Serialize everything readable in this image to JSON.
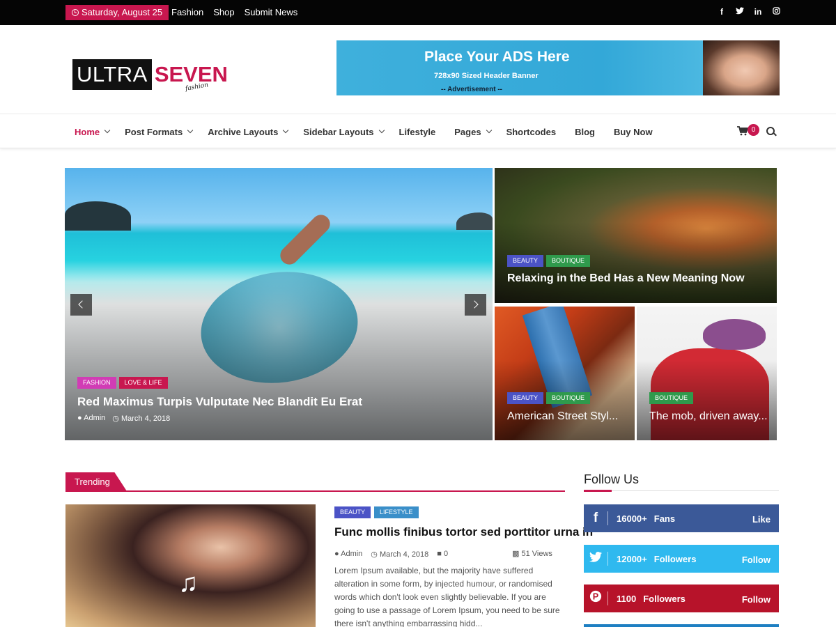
{
  "topbar": {
    "date": "Saturday, August 25",
    "links": [
      "Fashion",
      "Shop",
      "Submit News"
    ],
    "social_icons": [
      "f",
      "t",
      "in",
      "ig"
    ]
  },
  "logo": {
    "part1": "ULTRA",
    "part2": "SEVEN",
    "tagline": "fashion"
  },
  "ad": {
    "title": "Place Your ADS Here",
    "subtitle": "728x90 Sized Header Banner",
    "note": "-- Advertisement --"
  },
  "nav": {
    "items": [
      {
        "label": "Home",
        "dropdown": true,
        "active": true
      },
      {
        "label": "Post Formats",
        "dropdown": true
      },
      {
        "label": "Archive Layouts",
        "dropdown": true
      },
      {
        "label": "Sidebar Layouts",
        "dropdown": true
      },
      {
        "label": "Lifestyle",
        "dropdown": false
      },
      {
        "label": "Pages",
        "dropdown": true
      },
      {
        "label": "Shortcodes",
        "dropdown": false
      },
      {
        "label": "Blog",
        "dropdown": false
      },
      {
        "label": "Buy Now",
        "dropdown": false
      }
    ],
    "cart_count": "0"
  },
  "hero": {
    "main": {
      "tags": [
        {
          "label": "FASHION",
          "color": "#d13cb5"
        },
        {
          "label": "LOVE & LIFE",
          "color": "#c8174f"
        }
      ],
      "title": "Red Maximus Turpis Vulputate Nec Blandit Eu Erat",
      "author": "Admin",
      "date": "March 4, 2018"
    },
    "top_right": {
      "tags": [
        {
          "label": "BEAUTY",
          "color": "#4b53c6"
        },
        {
          "label": "BOUTIQUE",
          "color": "#2f9a4c"
        }
      ],
      "title": "Relaxing in the Bed Has a New Meaning Now"
    },
    "bottom_left": {
      "tags": [
        {
          "label": "BEAUTY",
          "color": "#4b53c6"
        },
        {
          "label": "BOUTIQUE",
          "color": "#2f9a4c"
        }
      ],
      "title": "American Street Styl..."
    },
    "bottom_right": {
      "tags": [
        {
          "label": "BOUTIQUE",
          "color": "#2f9a4c"
        }
      ],
      "title": "The mob, driven away..."
    }
  },
  "trending": {
    "heading": "Trending",
    "post": {
      "tags": [
        {
          "label": "BEAUTY",
          "color": "#4b53c6"
        },
        {
          "label": "LIFESTYLE",
          "color": "#3a8fc9"
        }
      ],
      "title": "Func mollis finibus tortor sed porttitor urna in",
      "author": "Admin",
      "date": "March 4, 2018",
      "comments": "0",
      "views": "51 Views",
      "excerpt": "Lorem Ipsum available, but the majority have suffered alteration in some form, by injected humour, or randomised words which don't look even slightly believable. If you are going to use a passage of Lorem Ipsum, you need to be sure there isn't anything embarrassing hidd..."
    }
  },
  "follow": {
    "heading": "Follow Us",
    "networks": [
      {
        "icon": "f",
        "count": "16000+",
        "label": "Fans",
        "action": "Like",
        "color": "#3b5998"
      },
      {
        "icon": "t",
        "count": "12000+",
        "label": "Followers",
        "action": "Follow",
        "color": "#2fb9ef"
      },
      {
        "icon": "p",
        "count": "1100",
        "label": "Followers",
        "action": "Follow",
        "color": "#b7132a"
      }
    ]
  },
  "colors": {
    "accent": "#c8174f",
    "topbar": "#050505"
  }
}
